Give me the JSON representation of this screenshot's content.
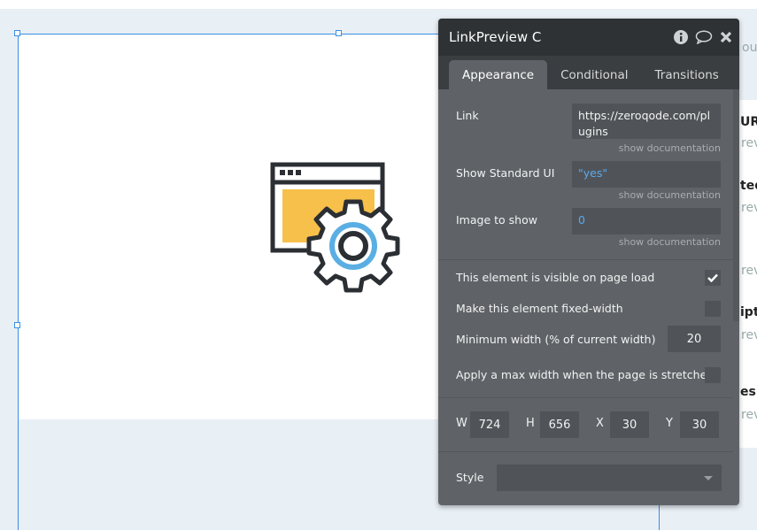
{
  "panel": {
    "title": "LinkPreview C",
    "icons": [
      "info-icon",
      "comment-icon",
      "close-icon"
    ],
    "tabs": [
      {
        "label": "Appearance",
        "active": true
      },
      {
        "label": "Conditional"
      },
      {
        "label": "Transitions"
      }
    ],
    "fields": {
      "link": {
        "label": "Link",
        "value": "https://zeroqode.com/plugins",
        "doc": "show documentation"
      },
      "show_standard_ui": {
        "label": "Show Standard UI",
        "value": "\"yes\"",
        "doc": "show documentation"
      },
      "image_to_show": {
        "label": "Image to show",
        "value": "0",
        "doc": "show documentation"
      }
    },
    "options": {
      "visible_on_load": {
        "label": "This element is visible on page load",
        "checked": true
      },
      "fixed_width": {
        "label": "Make this element fixed-width",
        "checked": false
      },
      "min_width": {
        "label": "Minimum width (% of current width)",
        "value": "20"
      },
      "max_width": {
        "label": "Apply a max width when the page is stretched",
        "checked": false
      }
    },
    "dimensions": {
      "w_label": "W",
      "w": "724",
      "h_label": "H",
      "h": "656",
      "x_label": "X",
      "x": "30",
      "y_label": "Y",
      "y": "30"
    },
    "style": {
      "label": "Style",
      "value": ""
    }
  },
  "right_fragments": [
    "ou c",
    "UR",
    "rev",
    "ted",
    "rev",
    "rev",
    "ipt",
    "rev",
    "es",
    "rev"
  ],
  "colors": {
    "accent": "#3a8ee6",
    "value_blue": "#5aa9f0",
    "icon_yellow": "#f7c04a",
    "icon_blue": "#5aaee3",
    "icon_dark": "#2b2f33"
  }
}
